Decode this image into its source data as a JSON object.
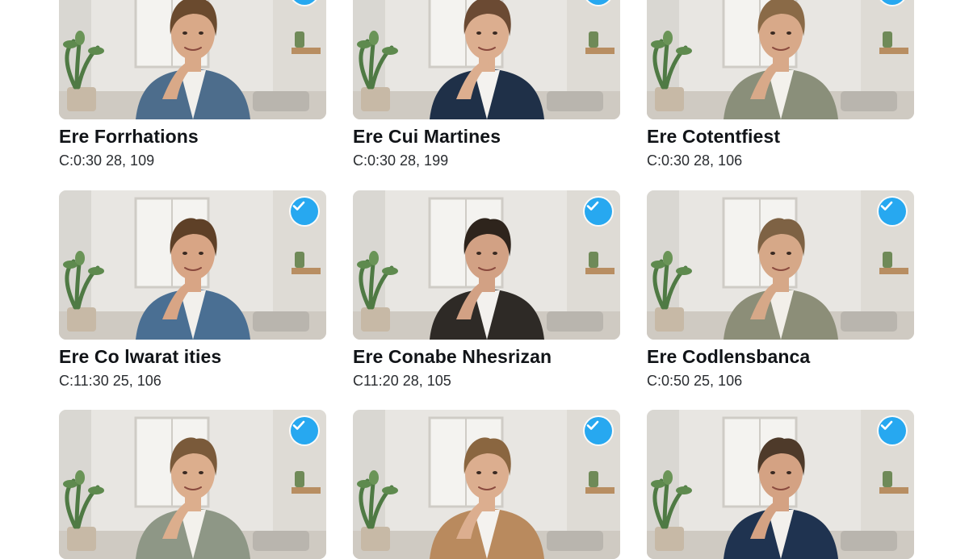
{
  "cards": [
    {
      "name": "Ere Forrhations",
      "meta": "C:0:30 28, 109",
      "selected": true,
      "shirt": "#4d6d8c",
      "inner": "#f2f0ec",
      "hair": "#6a4a2e",
      "skin": "#d9a988"
    },
    {
      "name": "Ere Cui Martines",
      "meta": "C:0:30 28, 199",
      "selected": true,
      "shirt": "#1f3048",
      "inner": "#f4f2ef",
      "hair": "#6b4a33",
      "skin": "#dcae8f"
    },
    {
      "name": "Ere Cotentfiest",
      "meta": "C:0:30 28, 106",
      "selected": true,
      "shirt": "#8a8f7a",
      "inner": "#f3f1ec",
      "hair": "#8a6a47",
      "skin": "#d8a989"
    },
    {
      "name": "Ere Co lwarat ities",
      "meta": "C:11:30 25, 106",
      "selected": true,
      "shirt": "#4a6f93",
      "inner": "#f2f0ec",
      "hair": "#5e4027",
      "skin": "#d8a585"
    },
    {
      "name": "Ere Conabe Nhesrizan",
      "meta": "C11:20 28, 105",
      "selected": true,
      "shirt": "#2e2a26",
      "inner": "#f3f1ee",
      "hair": "#2e241c",
      "skin": "#d2a184"
    },
    {
      "name": "Ere Codlensbanca",
      "meta": "C:0:50 25, 106",
      "selected": true,
      "shirt": "#8c8e78",
      "inner": "#f2efe9",
      "hair": "#7e6244",
      "skin": "#d6a888"
    },
    {
      "name": "",
      "meta": "",
      "selected": true,
      "shirt": "#8e9786",
      "inner": "#f3f1ec",
      "hair": "#7a5a3a",
      "skin": "#dcae8d"
    },
    {
      "name": "",
      "meta": "",
      "selected": true,
      "shirt": "#b98a5e",
      "inner": "#f4f2ef",
      "hair": "#8a6640",
      "skin": "#dcae8f"
    },
    {
      "name": "",
      "meta": "",
      "selected": true,
      "shirt": "#1f3350",
      "inner": "#f2f0ec",
      "hair": "#4e3a2a",
      "skin": "#d4a283"
    }
  ]
}
